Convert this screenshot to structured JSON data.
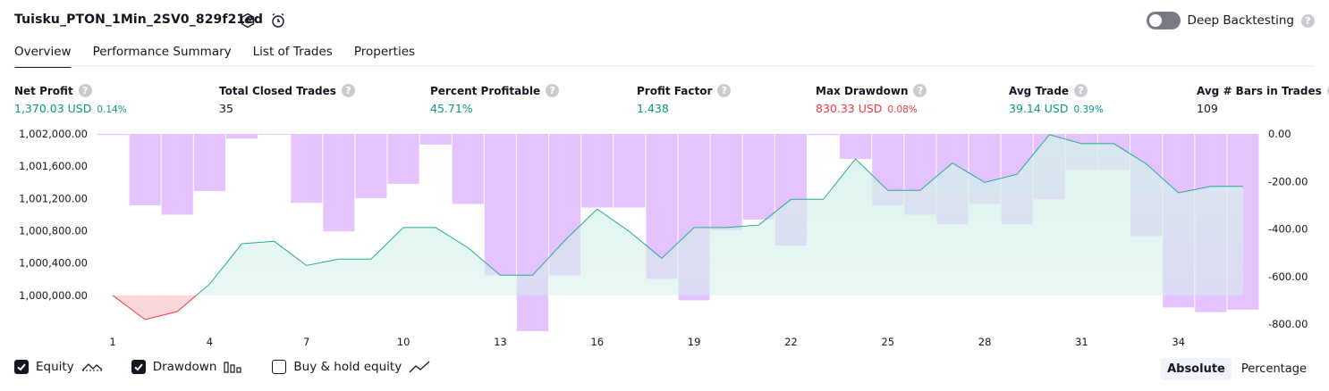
{
  "header": {
    "strategy_name": "Tuisku_PTON_1Min_2SV0_829f21ed",
    "deep_backtesting_label": "Deep Backtesting",
    "deep_backtesting_enabled": false,
    "help_glyph": "?"
  },
  "tabs": [
    {
      "label": "Overview",
      "active": true
    },
    {
      "label": "Performance Summary",
      "active": false
    },
    {
      "label": "List of Trades",
      "active": false
    },
    {
      "label": "Properties",
      "active": false
    }
  ],
  "metrics": {
    "net_profit": {
      "label": "Net Profit",
      "value": "1,370.03 USD",
      "pct": "0.14%"
    },
    "total_closed_trades": {
      "label": "Total Closed Trades",
      "value": "35"
    },
    "percent_profitable": {
      "label": "Percent Profitable",
      "value": "45.71%"
    },
    "profit_factor": {
      "label": "Profit Factor",
      "value": "1.438"
    },
    "max_drawdown": {
      "label": "Max Drawdown",
      "value": "830.33 USD",
      "pct": "0.08%"
    },
    "avg_trade": {
      "label": "Avg Trade",
      "value": "39.14 USD",
      "pct": "0.39%"
    },
    "avg_bars": {
      "label": "Avg # Bars in Trades",
      "value": "109"
    }
  },
  "colors": {
    "positive": "#089981",
    "negative": "#f23645",
    "equity_line": "#22ab94",
    "equity_fill": "#d5f0ea",
    "drawdown_fill": "#e1bcff",
    "negative_fill": "#fbd7da"
  },
  "chart_data": {
    "type": "area",
    "x_tick_labels": [
      "1",
      "4",
      "7",
      "10",
      "13",
      "16",
      "19",
      "22",
      "25",
      "28",
      "31",
      "34"
    ],
    "left_axis_ticks": [
      "1,002,000.00",
      "1,001,600.00",
      "1,001,200.00",
      "1,000,800.00",
      "1,000,400.00",
      "1,000,000.00"
    ],
    "right_axis_ticks": [
      "0.00",
      "-200.00",
      "-400.00",
      "-600.00",
      "-800.00"
    ],
    "left_ylim": [
      999645,
      1002000
    ],
    "right_ylim": [
      -800,
      0
    ],
    "series": [
      {
        "name": "Equity",
        "x": [
          1,
          2,
          3,
          4,
          5,
          6,
          7,
          8,
          9,
          10,
          11,
          12,
          13,
          14,
          15,
          16,
          17,
          18,
          19,
          20,
          21,
          22,
          23,
          24,
          25,
          26,
          27,
          28,
          29,
          30,
          31,
          32,
          33,
          34,
          35,
          36
        ],
        "values": [
          1000000,
          999700,
          999800,
          1000140,
          1000640,
          1000670,
          1000370,
          1000450,
          1000450,
          1000840,
          1000840,
          1000590,
          1000250,
          1000250,
          1000680,
          1001070,
          1000790,
          1000460,
          1000840,
          1000840,
          1000870,
          1001190,
          1001190,
          1001690,
          1001300,
          1001300,
          1001640,
          1001400,
          1001500,
          1001990,
          1001880,
          1001880,
          1001630,
          1001270,
          1001350,
          1001350
        ]
      },
      {
        "name": "Drawdown",
        "x": [
          1,
          2,
          3,
          4,
          5,
          6,
          7,
          8,
          9,
          10,
          11,
          12,
          13,
          14,
          15,
          16,
          17,
          18,
          19,
          20,
          21,
          22,
          23,
          24,
          25,
          26,
          27,
          28,
          29,
          30,
          31,
          32,
          33,
          34,
          35,
          36
        ],
        "values": [
          -5,
          -300,
          -340,
          -240,
          -20,
          0,
          -290,
          -410,
          -270,
          -210,
          -45,
          -295,
          -595,
          -830,
          -595,
          -310,
          -310,
          -610,
          -700,
          -405,
          -360,
          -470,
          -5,
          -105,
          -300,
          -340,
          -380,
          -295,
          -380,
          -275,
          -150,
          -150,
          -430,
          -730,
          -750,
          -740
        ]
      }
    ],
    "legend": [
      {
        "name": "Equity",
        "checked": true
      },
      {
        "name": "Drawdown",
        "checked": true
      },
      {
        "name": "Buy & hold equity",
        "checked": false
      }
    ],
    "grid": false,
    "legend_placement": "bottom-left"
  },
  "view_modes": {
    "absolute_label": "Absolute",
    "percentage_label": "Percentage",
    "selected": "Absolute"
  }
}
